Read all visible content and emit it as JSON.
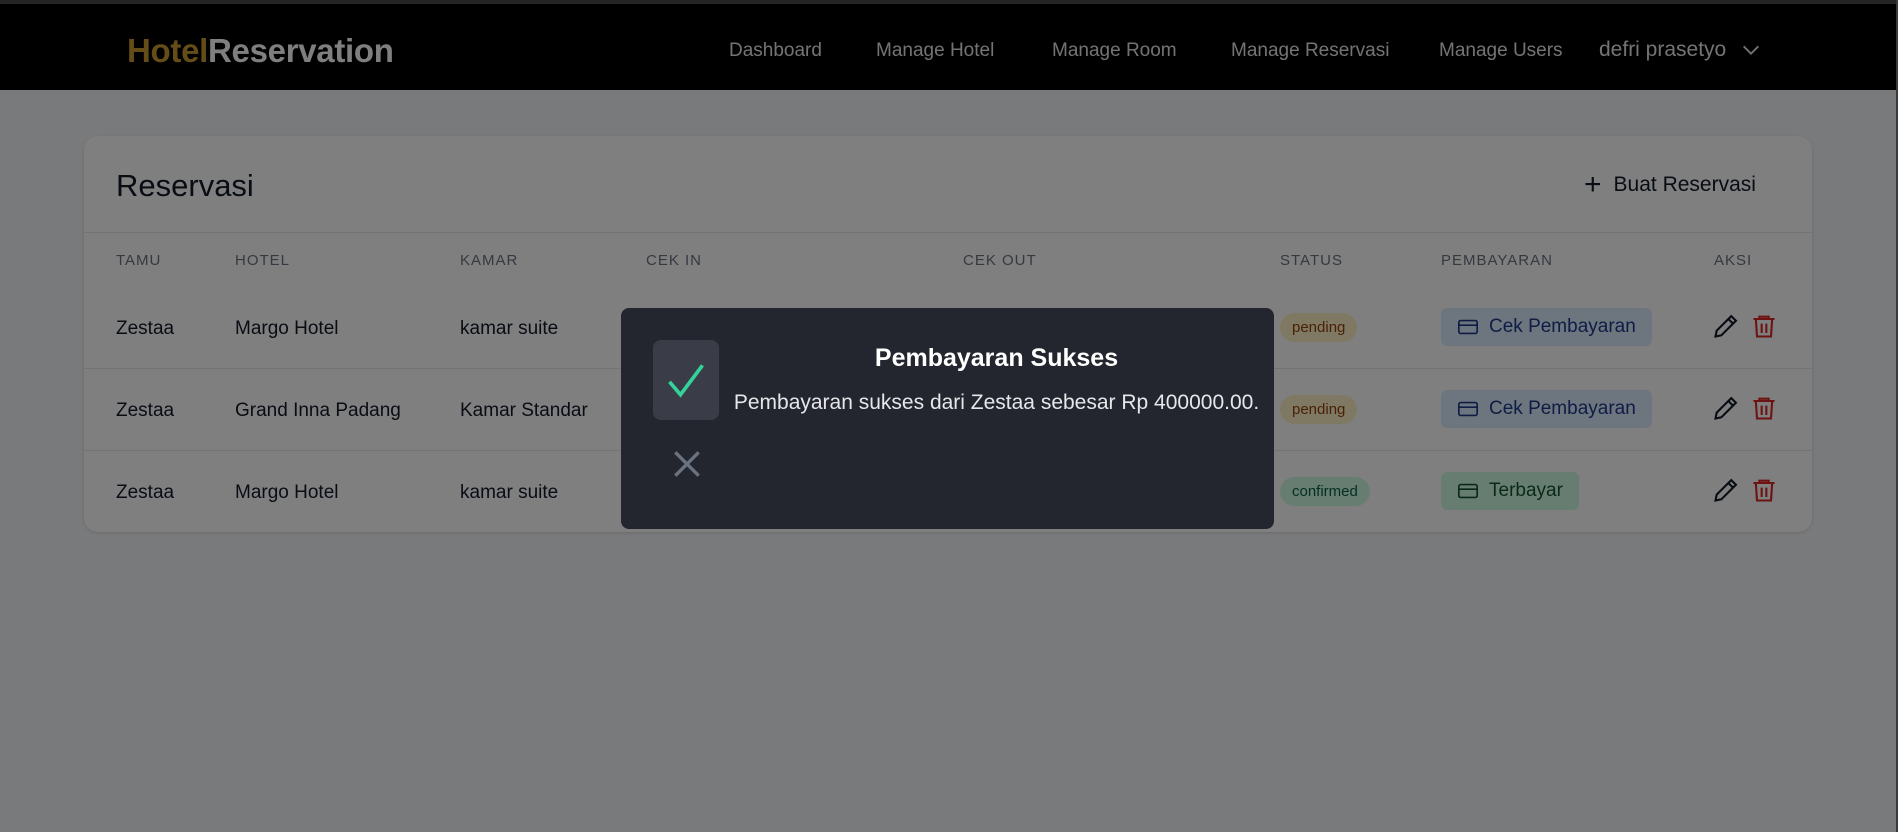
{
  "brand": {
    "part1": "Hotel",
    "part2": "Reservation"
  },
  "nav": {
    "links": [
      "Dashboard",
      "Manage Hotel",
      "Manage Room",
      "Manage Reservasi",
      "Manage Users"
    ],
    "user": "defri prasetyo"
  },
  "page": {
    "title": "Reservasi",
    "create_label": "Buat Reservasi"
  },
  "table": {
    "headers": [
      "TAMU",
      "HOTEL",
      "KAMAR",
      "CEK IN",
      "CEK OUT",
      "STATUS",
      "PEMBAYARAN",
      "AKSI"
    ],
    "rows": [
      {
        "guest": "Zestaa",
        "hotel": "Margo Hotel",
        "room": "kamar suite",
        "status": "pending",
        "payment": "Cek Pembayaran"
      },
      {
        "guest": "Zestaa",
        "hotel": "Grand Inna Padang",
        "room": "Kamar Standar",
        "status": "pending",
        "payment": "Cek Pembayaran"
      },
      {
        "guest": "Zestaa",
        "hotel": "Margo Hotel",
        "room": "kamar suite",
        "status": "confirmed",
        "payment": "Terbayar"
      }
    ]
  },
  "modal": {
    "title": "Pembayaran Sukses",
    "message": "Pembayaran sukses dari Zestaa sebesar Rp 400000.00."
  },
  "colors": {
    "brand_accent": "#c89b2c",
    "navbar_bg": "#000000",
    "pending_bg": "#fef3c7",
    "confirmed_bg": "#d1fae5",
    "check_pay_bg": "#dbeafe",
    "delete_red": "#dc2626",
    "success_green": "#34d399",
    "modal_bg": "#24262f"
  }
}
